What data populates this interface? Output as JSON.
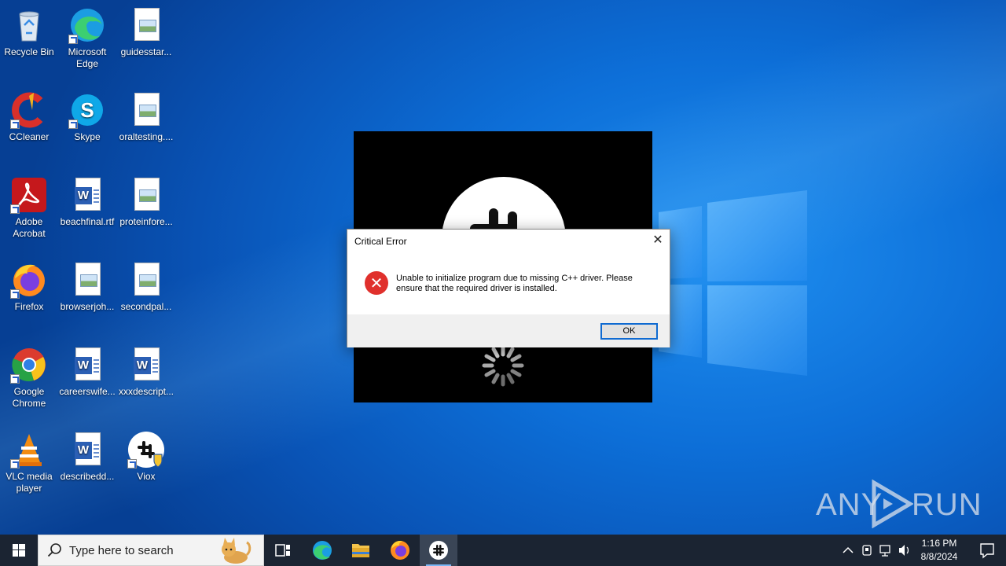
{
  "desktop": {
    "icons": [
      {
        "label": "Recycle Bin",
        "icon": "recycle-bin-icon"
      },
      {
        "label": "Microsoft Edge",
        "icon": "edge-icon"
      },
      {
        "label": "guidesstar...",
        "icon": "image-file-icon"
      },
      {
        "label": "CCleaner",
        "icon": "ccleaner-icon"
      },
      {
        "label": "Skype",
        "icon": "skype-icon"
      },
      {
        "label": "oraltesting....",
        "icon": "image-file-icon"
      },
      {
        "label": "Adobe Acrobat",
        "icon": "acrobat-icon"
      },
      {
        "label": "beachfinal.rtf",
        "icon": "word-doc-icon"
      },
      {
        "label": "proteinfore...",
        "icon": "image-file-icon"
      },
      {
        "label": "Firefox",
        "icon": "firefox-icon"
      },
      {
        "label": "browserjoh...",
        "icon": "image-file-icon"
      },
      {
        "label": "secondpal...",
        "icon": "image-file-icon"
      },
      {
        "label": "Google Chrome",
        "icon": "chrome-icon"
      },
      {
        "label": "careerswife...",
        "icon": "word-doc-icon"
      },
      {
        "label": "xxxdescript...",
        "icon": "word-doc-icon"
      },
      {
        "label": "VLC media player",
        "icon": "vlc-icon"
      },
      {
        "label": "describedd...",
        "icon": "word-doc-icon"
      },
      {
        "label": "Viox",
        "icon": "viox-slack-icon"
      }
    ]
  },
  "dialog": {
    "title": "Critical Error",
    "message": "Unable to initialize program due to missing C++ driver. Please ensure that the required driver is installed.",
    "ok_label": "OK",
    "close_glyph": "✕",
    "error_glyph": "✕"
  },
  "watermark": {
    "left": "ANY",
    "right": "RUN"
  },
  "taskbar": {
    "search_placeholder": "Type here to search",
    "clock_time": "1:16 PM",
    "clock_date": "8/8/2024"
  },
  "colors": {
    "desktop_blue": "#0d6fd8",
    "taskbar": "#1b2432",
    "error_red": "#e0302c",
    "button_focus": "#0f6ad1"
  }
}
